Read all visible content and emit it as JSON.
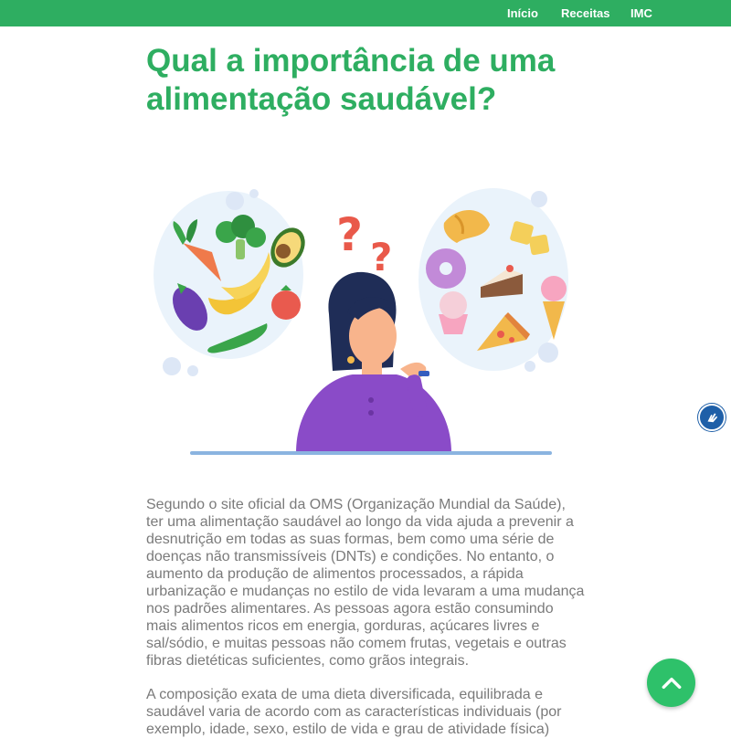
{
  "nav": {
    "items": [
      {
        "label": "Início"
      },
      {
        "label": "Receitas"
      },
      {
        "label": "IMC"
      }
    ]
  },
  "article": {
    "title": "Qual a importância de uma alimentação saudável?",
    "paragraphs": [
      "Segundo o site oficial da OMS (Organização Mundial da Saúde), ter uma alimentação saudável ao longo da vida ajuda a prevenir a desnutrição em todas as suas formas, bem como uma série de doenças não transmissíveis (DNTs) e condições. No entanto, o aumento da produção de alimentos processados, a rápida urbanização e mudanças no estilo de vida levaram a uma mudança nos padrões alimentares. As pessoas agora estão consumindo mais alimentos ricos em energia, gorduras, açúcares livres e sal/sódio, e muitas pessoas não comem frutas, vegetais e outras fibras dietéticas suficientes, como grãos integrais.",
      "A composição exata de uma dieta diversificada, equilibrada e saudável varia de acordo com as características individuais (por exemplo, idade, sexo, estilo de vida e grau de atividade física)"
    ]
  },
  "illustration": {
    "icon": "woman-thinking-healthy-vs-junk-food-illustration"
  },
  "floating": {
    "accessibility_icon": "sign-language-hands-icon",
    "scroll_top_icon": "chevron-up-icon"
  },
  "colors": {
    "brand_green": "#2eae61",
    "scroll_button_green": "#2ec16a",
    "body_text": "#7a7a7a",
    "accessibility_blue": "#1e5fa8"
  }
}
